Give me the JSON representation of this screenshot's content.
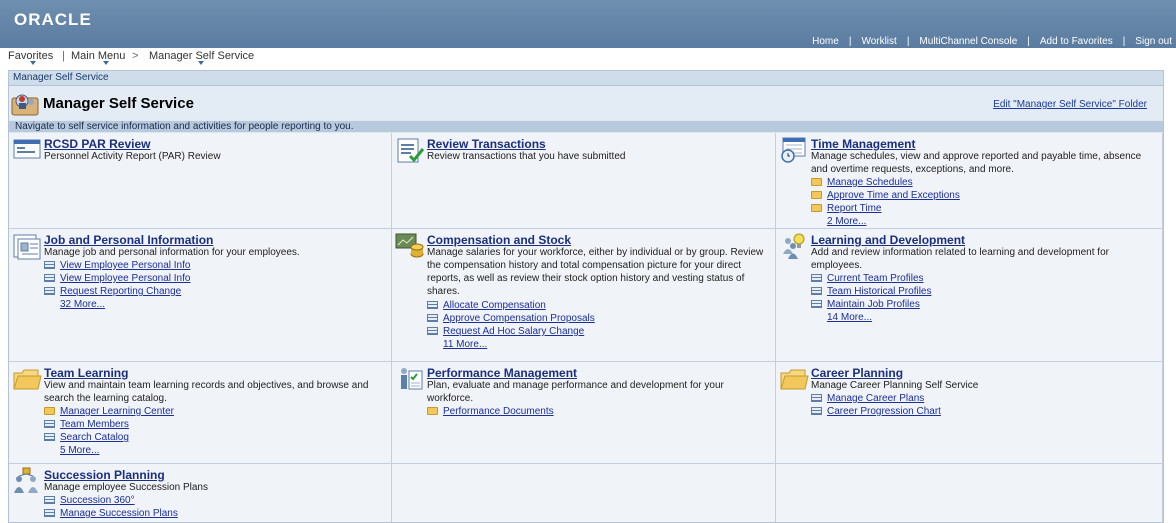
{
  "header": {
    "logo": "ORACLE",
    "links": [
      "Home",
      "Worklist",
      "MultiChannel Console",
      "Add to Favorites",
      "Sign out"
    ],
    "separator": "|"
  },
  "breadcrumb": {
    "favorites": "Favorites",
    "main_menu": "Main Menu",
    "arrow": ">",
    "current": "Manager Self Service"
  },
  "pagelet": {
    "header_label": "Manager Self Service",
    "title": "Manager Self Service",
    "edit_link": "Edit \"Manager Self Service\" Folder",
    "instructions": "Navigate to self service information and activities for people reporting to you."
  },
  "cells": {
    "rcsd": {
      "title": "RCSD PAR Review",
      "desc": "Personnel Activity Report (PAR) Review"
    },
    "review": {
      "title": "Review Transactions",
      "desc": "Review transactions that you have submitted"
    },
    "time": {
      "title": "Time Management",
      "desc": "Manage schedules, view and approve reported and payable time, absence and overtime requests, exceptions, and more.",
      "links": [
        "Manage Schedules",
        "Approve Time and Exceptions",
        "Report Time"
      ],
      "link_icon": "folder-icon",
      "more": "2 More..."
    },
    "job": {
      "title": "Job and Personal Information",
      "desc": "Manage job and personal information for your employees.",
      "links": [
        "View Employee Personal Info",
        "View Employee Personal Info",
        "Request Reporting Change"
      ],
      "link_icon": "page-icon",
      "more": "32 More..."
    },
    "comp": {
      "title": "Compensation and Stock",
      "desc": "Manage salaries for your workforce, either by individual or by group. Review the compensation history and total compensation picture for your direct reports, as well as review their stock option history and vesting status of shares.",
      "links": [
        "Allocate Compensation",
        "Approve Compensation Proposals",
        "Request Ad Hoc Salary Change"
      ],
      "link_icon": "page-icon",
      "more": "11 More..."
    },
    "learning": {
      "title": "Learning and Development",
      "desc": "Add and review information related to learning and development for employees.",
      "links": [
        "Current Team Profiles",
        "Team Historical Profiles",
        "Maintain Job Profiles"
      ],
      "link_icon": "page-icon",
      "more": "14 More..."
    },
    "team": {
      "title": "Team Learning",
      "desc": "View and maintain team learning records and objectives, and browse and search the learning catalog.",
      "links": [
        "Manager Learning Center",
        "Team Members",
        "Search Catalog"
      ],
      "link_icon": "page-icon",
      "more": "5 More..."
    },
    "perf": {
      "title": "Performance Management",
      "desc": "Plan, evaluate and manage performance and development for your workforce.",
      "links": [
        "Performance Documents"
      ],
      "link_icon": "folder-icon"
    },
    "career": {
      "title": "Career Planning",
      "desc": "Manage Career Planning Self Service",
      "links": [
        "Manage Career Plans",
        "Career Progression Chart"
      ],
      "link_icon": "page-icon"
    },
    "succession": {
      "title": "Succession Planning",
      "desc": "Manage employee Succession Plans",
      "links": [
        "Succession 360°",
        "Manage Succession Plans"
      ],
      "link_icon": "page-icon"
    }
  },
  "colors": {
    "topbar": "#5f81a5",
    "link": "#1b2f9b",
    "title_link": "#1b2f80",
    "grid_bg": "#f0f3f7"
  }
}
